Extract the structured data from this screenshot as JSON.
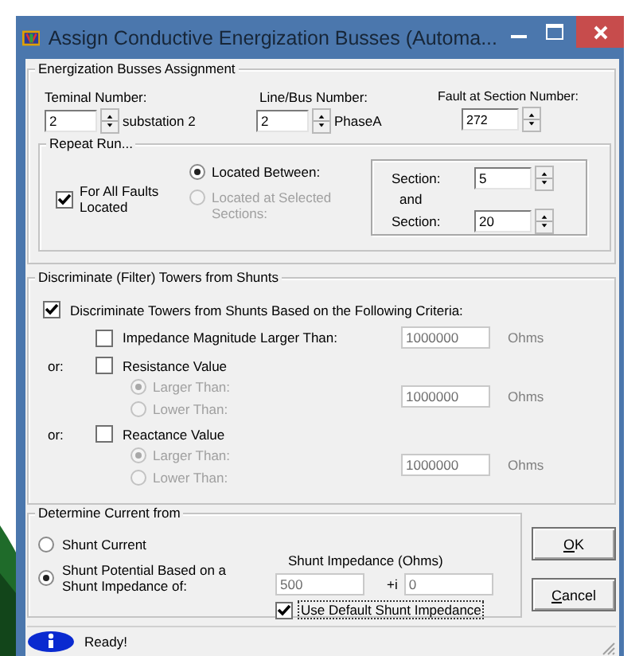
{
  "window": {
    "title": "Assign Conductive Energization Busses (Automa..."
  },
  "assignment": {
    "title": "Energization Busses Assignment",
    "fields": [
      {
        "label": "Teminal Number:",
        "value": "2",
        "suffix": "substation 2"
      },
      {
        "label": "Line/Bus Number:",
        "value": "2",
        "suffix": "PhaseA"
      },
      {
        "label": "Fault at Section Number:",
        "value": "272"
      }
    ],
    "repeat_run": {
      "title": "Repeat Run...",
      "all_faults": {
        "label": "For All Faults Located",
        "checked": true
      },
      "options": [
        {
          "label": "Located Between:",
          "selected": true,
          "disabled": false
        },
        {
          "label": "Located at Selected Sections:",
          "selected": false,
          "disabled": true
        }
      ],
      "sections": [
        {
          "label": "Section:",
          "value": "5"
        },
        {
          "label": "Section:",
          "value": "20"
        }
      ],
      "and_label": "and"
    }
  },
  "discriminate": {
    "title": "Discriminate (Filter) Towers from Shunts",
    "main": {
      "label": "Discriminate Towers from Shunts Based on the Following Criteria:",
      "checked": true
    },
    "criteria": [
      {
        "label": "Impedance Magnitude Larger Than:",
        "checked": false,
        "value": "1000000",
        "unit": "Ohms"
      },
      {
        "prefix": "or:",
        "label": "Resistance Value",
        "checked": false,
        "value": "1000000",
        "unit": "Ohms",
        "options": [
          {
            "label": "Larger Than:",
            "selected": true,
            "disabled": true
          },
          {
            "label": "Lower Than:",
            "selected": false,
            "disabled": true
          }
        ]
      },
      {
        "prefix": "or:",
        "label": "Reactance Value",
        "checked": false,
        "value": "1000000",
        "unit": "Ohms",
        "options": [
          {
            "label": "Larger Than:",
            "selected": true,
            "disabled": true
          },
          {
            "label": "Lower Than:",
            "selected": false,
            "disabled": true
          }
        ]
      }
    ]
  },
  "current": {
    "title": "Determine Current from",
    "options": [
      {
        "label": "Shunt Current",
        "selected": false
      },
      {
        "label": "Shunt Potential  Based on a Shunt Impedance of:",
        "selected": true
      }
    ],
    "impedance": {
      "heading": "Shunt Impedance (Ohms)",
      "real": "500",
      "imag_label": "+i",
      "imag": "0",
      "disabled": true
    },
    "use_default": {
      "label": "Use Default Shunt Impedance",
      "checked": true,
      "focused": true
    }
  },
  "buttons": [
    {
      "label": "OK",
      "first_letter_underlined": true
    },
    {
      "label": "Cancel",
      "first_letter_underlined": true
    }
  ],
  "status_bar": {
    "text": "Ready!"
  }
}
